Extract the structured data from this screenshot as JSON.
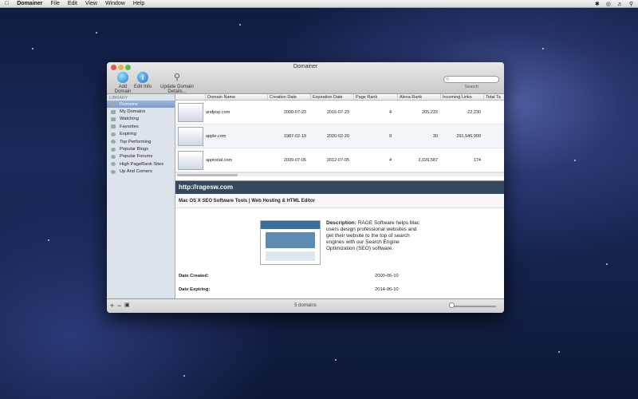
{
  "menubar": {
    "apple": "",
    "app_name": "Domainer",
    "items": [
      "File",
      "Edit",
      "View",
      "Window",
      "Help"
    ]
  },
  "window": {
    "title": "Domainer",
    "toolbar": {
      "add_domain": "Add Domain",
      "edit_info": "Edit Info",
      "update_details": "Update Domain Details..."
    },
    "search": {
      "placeholder": "",
      "label": "Search"
    }
  },
  "sidebar": {
    "header": "LIBRARY",
    "items": [
      {
        "label": "Domains",
        "selected": true
      },
      {
        "label": "My Domains"
      },
      {
        "label": "Watching"
      },
      {
        "label": "Favorites"
      },
      {
        "label": "Expiring"
      },
      {
        "label": "Top Performing"
      },
      {
        "label": "Popular Blogs"
      },
      {
        "label": "Popular Forums"
      },
      {
        "label": "High PageRank Sites"
      },
      {
        "label": "Up And Comers"
      }
    ]
  },
  "table": {
    "columns": [
      "Domain Name",
      "Creation Date",
      "Expiration Date",
      "Page Rank",
      "Alexa Rank",
      "Incoming Links",
      "Total Ta"
    ],
    "rows": [
      {
        "name": "andpop.com",
        "created": "2000-07-23",
        "expires": "2016-07-23",
        "pagerank": "4",
        "alexa": "205,233",
        "links": "22,230"
      },
      {
        "name": "apple.com",
        "created": "1987-02-19",
        "expires": "2020-02-20",
        "pagerank": "9",
        "alexa": "30",
        "links": "291,546,900"
      },
      {
        "name": "apptorial.com",
        "created": "2009-07-05",
        "expires": "2012-07-05",
        "pagerank": "4",
        "alexa": "2,026,587",
        "links": "174"
      }
    ]
  },
  "detail": {
    "url": "http://ragesw.com",
    "page_title": "Mac OS X SEO Software Tools | Web Hosting & HTML Editor",
    "description_label": "Description:",
    "description": "RAGE Software helps Mac users design professional websites and get their website to the top of search engines with our Search Engine Optimization (SEO) software.",
    "date_created_label": "Date Created:",
    "date_created": "2000-06-10",
    "date_expiring_label": "Date Expiring:",
    "date_expiring": "2014-06-10"
  },
  "status": {
    "count": "5 domains"
  },
  "colors": {
    "url_bar": "#34495e",
    "selection": "#7e9ccc"
  }
}
